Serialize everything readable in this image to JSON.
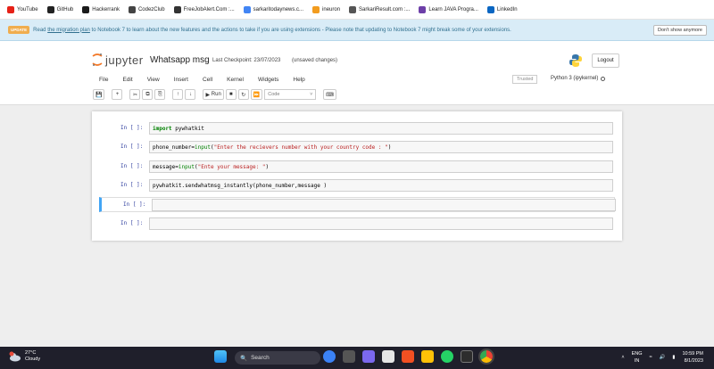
{
  "bookmarks": [
    {
      "label": "YouTube",
      "color": "#e62117"
    },
    {
      "label": "GitHub",
      "color": "#222222"
    },
    {
      "label": "Hackerrank",
      "color": "#1b1b1b"
    },
    {
      "label": "CodezClub",
      "color": "#444444"
    },
    {
      "label": "FreeJobAlert.Com :...",
      "color": "#333333"
    },
    {
      "label": "sarkaritodaynews.c...",
      "color": "#4285f4"
    },
    {
      "label": "ineuron",
      "color": "#f29c1f"
    },
    {
      "label": "SarkariResult.com :...",
      "color": "#555555"
    },
    {
      "label": "Learn JAVA Progra...",
      "color": "#6d3fa8"
    },
    {
      "label": "LinkedIn",
      "color": "#0a66c2"
    }
  ],
  "banner": {
    "badge": "UPDATE",
    "text_prefix": "Read ",
    "link": "the migration plan",
    "text_suffix": " to Notebook 7 to learn about the new features and the actions to take if you are using extensions - Please note that updating to Notebook 7 might break some of your extensions.",
    "dismiss": "Don't show anymore"
  },
  "header": {
    "logo_text": "jupyter",
    "notebook_name": "Whatsapp msg",
    "checkpoint": "Last Checkpoint: 23/07/2023",
    "unsaved": "(unsaved changes)",
    "logout": "Logout"
  },
  "menu": [
    "File",
    "Edit",
    "View",
    "Insert",
    "Cell",
    "Kernel",
    "Widgets",
    "Help"
  ],
  "trusted": "Trusted",
  "kernel": "Python 3 (ipykernel)",
  "toolbar": {
    "run_label": "Run",
    "cell_type": "Code"
  },
  "cells": [
    {
      "prompt": "In [ ]:",
      "parts": [
        {
          "t": "import",
          "c": "kw"
        },
        {
          "t": " pywhatkit",
          "c": ""
        }
      ]
    },
    {
      "prompt": "In [ ]:",
      "parts": [
        {
          "t": "phone_number=",
          "c": ""
        },
        {
          "t": "input",
          "c": "bi"
        },
        {
          "t": "(",
          "c": ""
        },
        {
          "t": "\"Enter the recievers number with your country code : \"",
          "c": "str"
        },
        {
          "t": ")",
          "c": ""
        }
      ]
    },
    {
      "prompt": "In [ ]:",
      "parts": [
        {
          "t": "message=",
          "c": ""
        },
        {
          "t": "input",
          "c": "bi"
        },
        {
          "t": "(",
          "c": ""
        },
        {
          "t": "\"Ente your message: \"",
          "c": "str"
        },
        {
          "t": ")",
          "c": ""
        }
      ]
    },
    {
      "prompt": "In [ ]:",
      "parts": [
        {
          "t": "pywhatkit.sendwhatmsg_instantly(phone_number,message )",
          "c": ""
        }
      ]
    },
    {
      "prompt": "In [ ]:",
      "parts": []
    },
    {
      "prompt": "In [ ]:",
      "parts": []
    }
  ],
  "taskbar": {
    "temp": "27°C",
    "condition": "Cloudy",
    "search": "Search",
    "lang1": "ENG",
    "lang2": "IN",
    "time": "10:59 PM",
    "date": "8/1/2023"
  }
}
